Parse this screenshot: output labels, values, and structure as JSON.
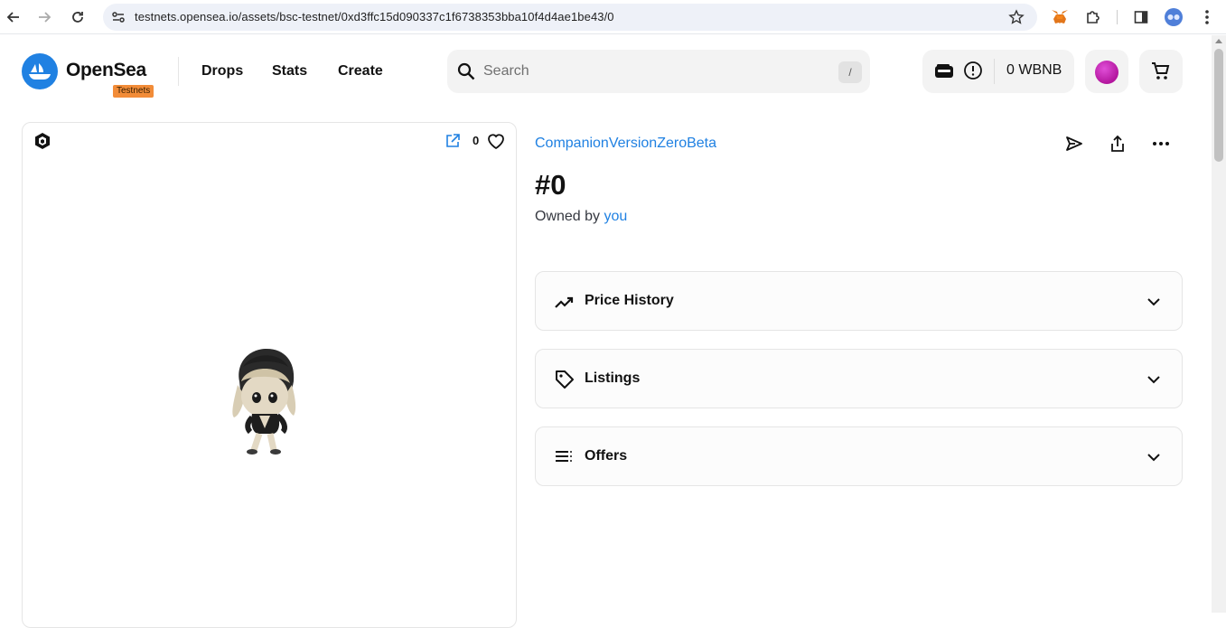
{
  "browser": {
    "url": "testnets.opensea.io/assets/bsc-testnet/0xd3ffc15d090337c1f6738353bba10f4d4ae1be43/0"
  },
  "header": {
    "logo_text": "OpenSea",
    "badge": "Testnets",
    "nav": [
      "Drops",
      "Stats",
      "Create"
    ],
    "search_placeholder": "Search",
    "search_shortcut": "/",
    "wallet_balance": "0 WBNB"
  },
  "media": {
    "favorites_count": "0"
  },
  "item": {
    "collection": "CompanionVersionZeroBeta",
    "title": "#0",
    "owned_by_label": "Owned by",
    "owner": "you"
  },
  "sections": [
    {
      "label": "Price History",
      "icon": "trending-icon"
    },
    {
      "label": "Listings",
      "icon": "tag-icon"
    },
    {
      "label": "Offers",
      "icon": "list-icon"
    }
  ],
  "colors": {
    "brand": "#2081e2",
    "badge": "#f28c38"
  }
}
